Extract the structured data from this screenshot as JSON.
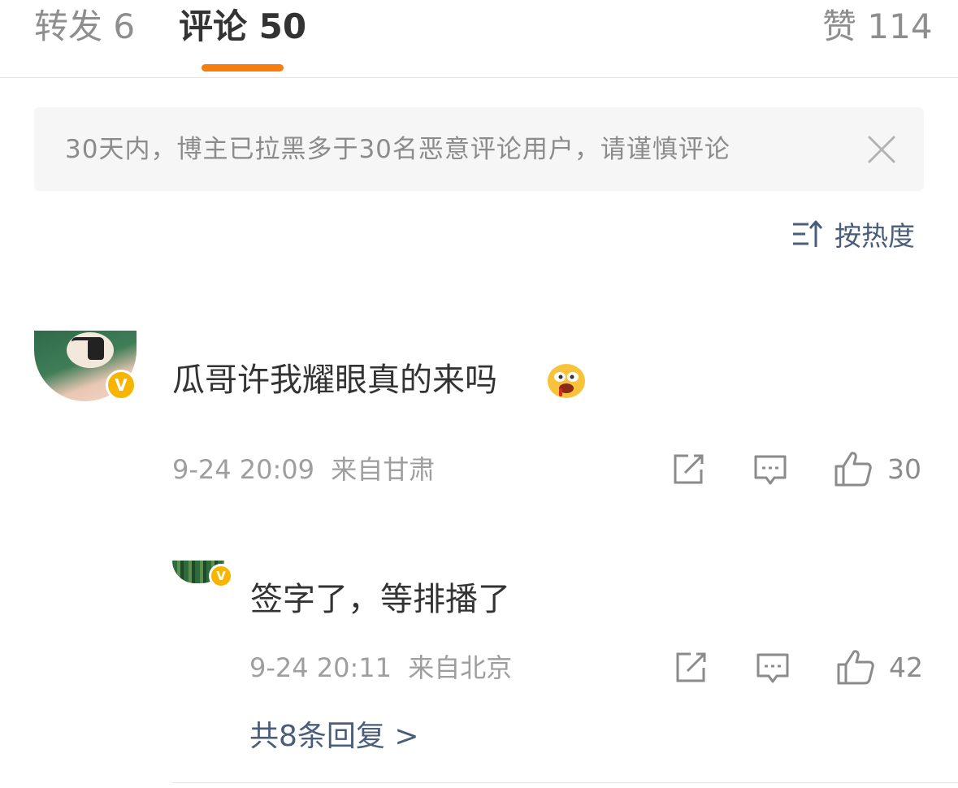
{
  "tabs": {
    "repost": {
      "label": "转发",
      "count": "6"
    },
    "comments": {
      "label": "评论",
      "count": "50"
    },
    "likes": {
      "label": "赞",
      "count": "114"
    }
  },
  "notice": {
    "text": "30天内，博主已拉黑多于30名恶意评论用户，请谨慎评论"
  },
  "sort": {
    "label": "按热度"
  },
  "comment": {
    "text": "瓜哥许我耀眼真的来吗",
    "date": "9-24 20:09",
    "location": "来自甘肃",
    "like_count": "30"
  },
  "reply": {
    "text": "签字了，等排播了",
    "date": "9-24 20:11",
    "location": "来自北京",
    "like_count": "42"
  },
  "more_replies": {
    "label": "共8条回复 >"
  },
  "colors": {
    "accent_orange": "#f77d0f",
    "link_blue_gray": "#4a5d7a",
    "verified_badge": "#f7b500"
  },
  "icons": [
    "close-icon",
    "sort-icon",
    "share-icon",
    "comment-icon",
    "like-icon",
    "verified-badge-icon",
    "emoji-icon"
  ]
}
